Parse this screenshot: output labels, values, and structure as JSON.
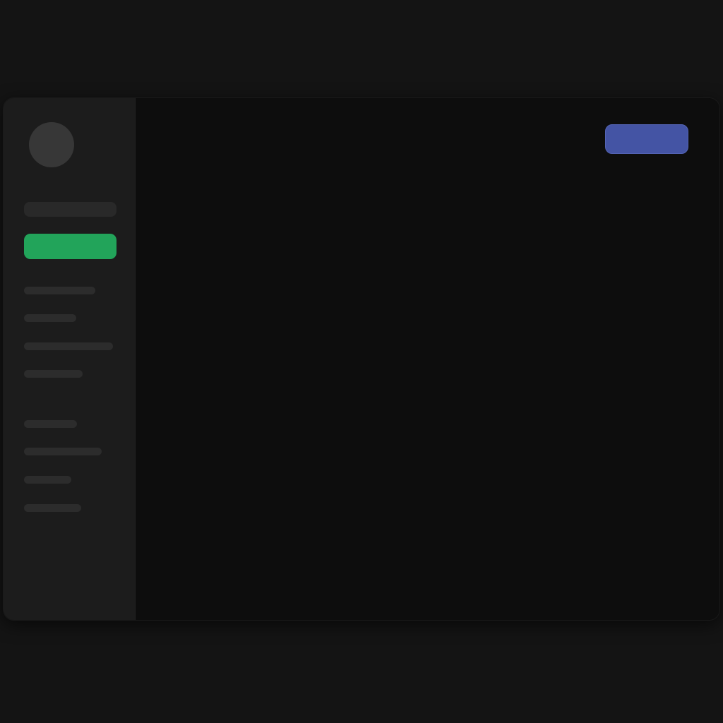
{
  "colors": {
    "background": "#141414",
    "window": "#0d0d0d",
    "sidebar": "#1c1c1c",
    "primary_accent": "#22a45a",
    "header_accent": "#4454a4",
    "placeholder": "#2c2c2c"
  },
  "sidebar": {
    "avatar_icon": "avatar",
    "search_label": "",
    "primary_button_label": "",
    "nav_group_1": [
      {
        "label": ""
      },
      {
        "label": ""
      },
      {
        "label": ""
      },
      {
        "label": ""
      }
    ],
    "nav_group_2": [
      {
        "label": ""
      },
      {
        "label": ""
      },
      {
        "label": ""
      },
      {
        "label": ""
      }
    ]
  },
  "header": {
    "action_button_label": ""
  }
}
